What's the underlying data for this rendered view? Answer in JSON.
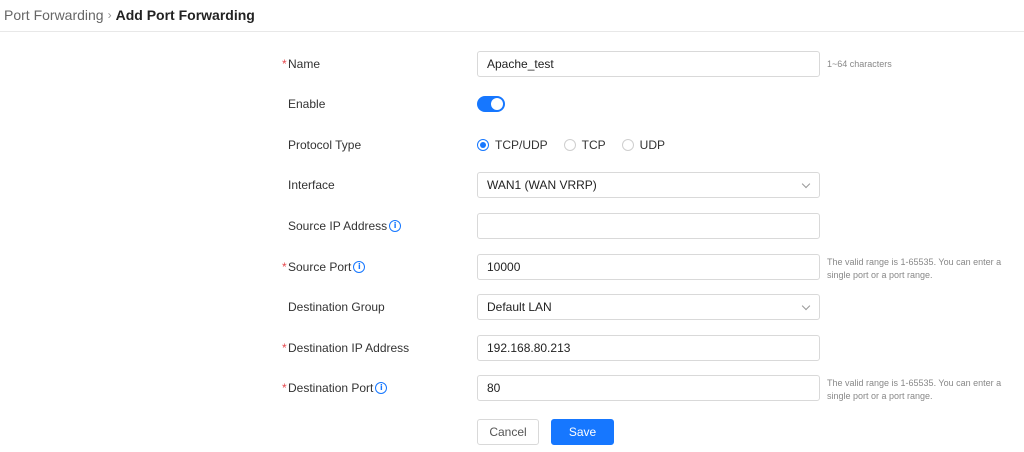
{
  "breadcrumb": {
    "parent": "Port Forwarding",
    "separator": "›",
    "current": "Add Port Forwarding"
  },
  "form": {
    "name": {
      "label": "Name",
      "value": "Apache_test",
      "hint": "1~64 characters"
    },
    "enable": {
      "label": "Enable",
      "on": true
    },
    "protocol": {
      "label": "Protocol Type",
      "options": [
        "TCP/UDP",
        "TCP",
        "UDP"
      ],
      "selected": "TCP/UDP"
    },
    "interface": {
      "label": "Interface",
      "value": "WAN1 (WAN VRRP)"
    },
    "source_ip": {
      "label": "Source IP Address",
      "value": ""
    },
    "source_port": {
      "label": "Source Port",
      "value": "10000",
      "hint": "The valid range is 1-65535. You can enter a single port or a port range."
    },
    "destination_group": {
      "label": "Destination Group",
      "value": "Default LAN"
    },
    "destination_ip": {
      "label": "Destination IP Address",
      "value": "192.168.80.213"
    },
    "destination_port": {
      "label": "Destination Port",
      "value": "80",
      "hint": "The valid range is 1-65535. You can enter a single port or a port range."
    },
    "required_marker": "*",
    "info_glyph": "i"
  },
  "actions": {
    "cancel_label": "Cancel",
    "save_label": "Save"
  },
  "colors": {
    "accent": "#1677ff",
    "required": "#e5484d"
  }
}
